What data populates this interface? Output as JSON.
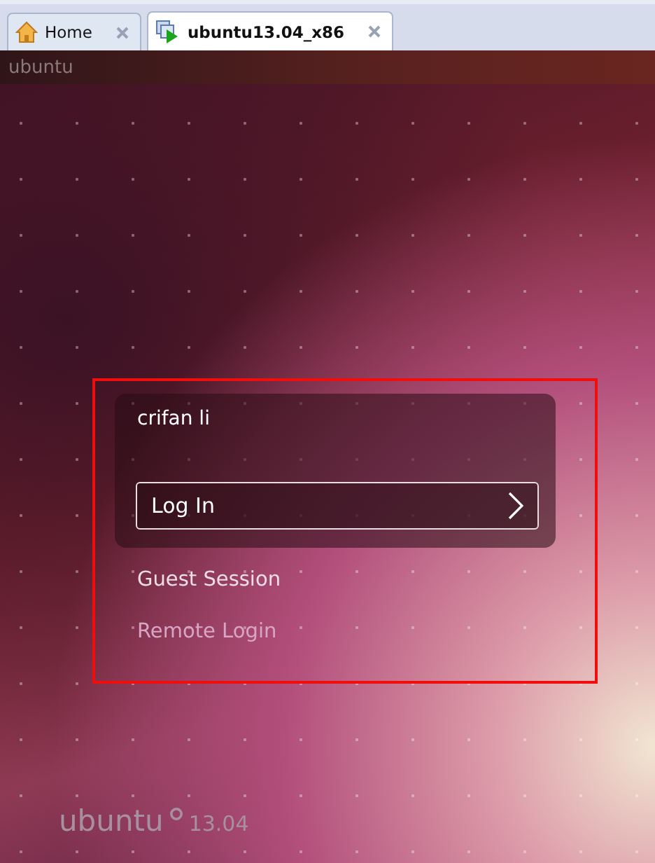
{
  "tabs": [
    {
      "label": "Home",
      "kind": "home",
      "selected": false
    },
    {
      "label": "ubuntu13.04_x86",
      "kind": "vm",
      "selected": true
    }
  ],
  "top_panel": {
    "title": "ubuntu"
  },
  "login": {
    "user": "crifan li",
    "button": "Log In",
    "options": [
      {
        "label": "Guest Session",
        "dimmed": false
      },
      {
        "label": "Remote Login",
        "dimmed": true
      }
    ]
  },
  "branding": {
    "name": "ubuntu",
    "version": "13.04"
  }
}
